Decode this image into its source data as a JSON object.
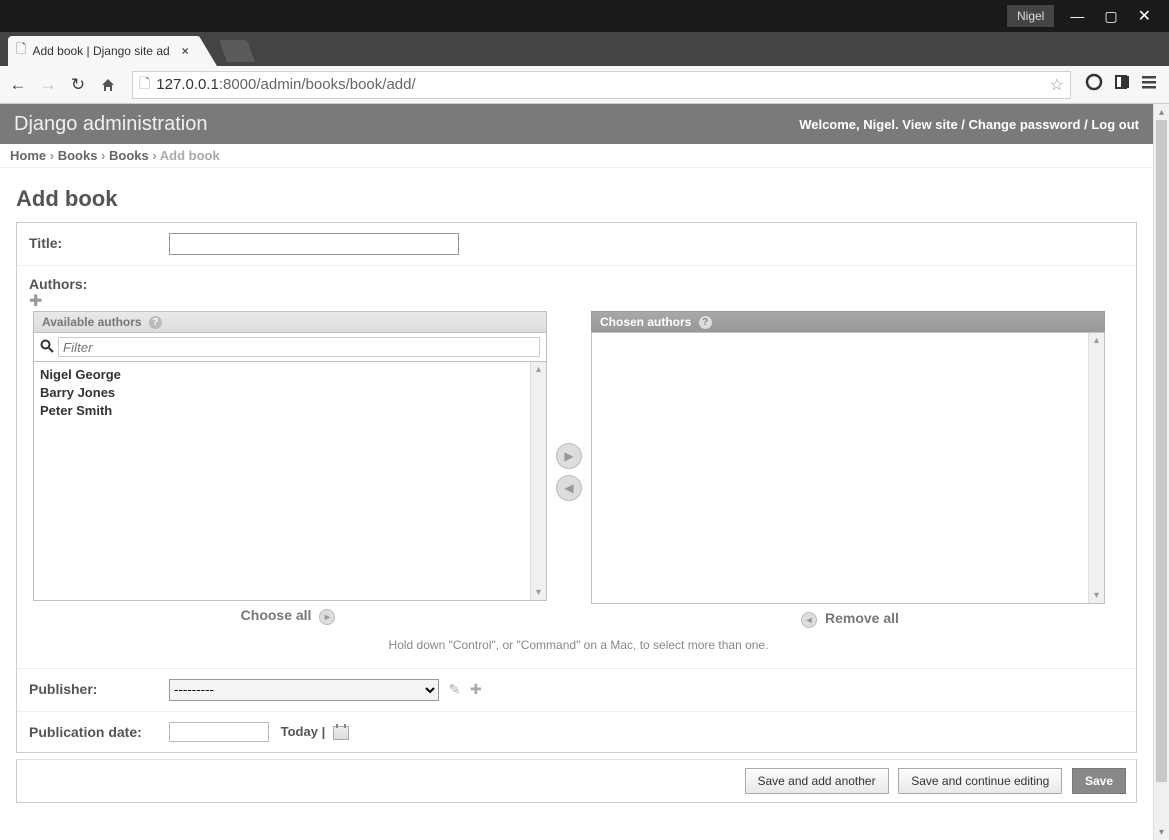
{
  "window": {
    "user_tag": "Nigel",
    "tab_title": "Add book | Django site ad",
    "url_display_ip": "127.0.0.1",
    "url_display_port_path": ":8000/admin/books/book/add/"
  },
  "header": {
    "site_title": "Django administration",
    "welcome": "Welcome, Nigel.",
    "view_site": "View site",
    "change_password": "Change password",
    "log_out": "Log out"
  },
  "breadcrumbs": {
    "home": "Home",
    "app": "Books",
    "model": "Books",
    "action": "Add book"
  },
  "page": {
    "title": "Add book"
  },
  "form": {
    "title_label": "Title:",
    "title_value": "",
    "authors_label": "Authors:",
    "available_header": "Available authors",
    "chosen_header": "Chosen authors",
    "filter_placeholder": "Filter",
    "available_list": [
      "Nigel George",
      "Barry Jones",
      "Peter Smith"
    ],
    "chosen_list": [],
    "choose_all": "Choose all",
    "remove_all": "Remove all",
    "help_text": "Hold down \"Control\", or \"Command\" on a Mac, to select more than one.",
    "publisher_label": "Publisher:",
    "publisher_selected": "---------",
    "pubdate_label": "Publication date:",
    "pubdate_value": "",
    "today_label": "Today",
    "save_add_another": "Save and add another",
    "save_continue": "Save and continue editing",
    "save": "Save"
  }
}
